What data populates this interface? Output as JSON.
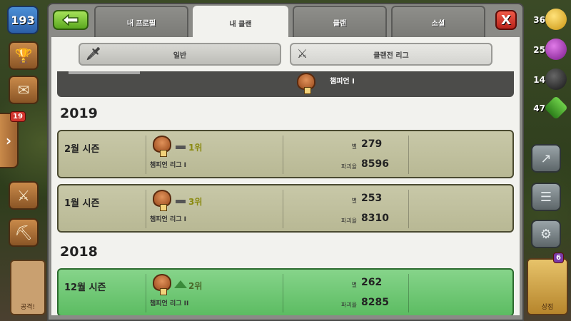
{
  "hud": {
    "level": "193",
    "messages_badge": "19",
    "attack_label": "공격!",
    "shop_badge": "6",
    "shop_label": "상점",
    "resources": [
      {
        "name": "gold",
        "value": "36"
      },
      {
        "name": "elixir",
        "value": "25"
      },
      {
        "name": "dark-elixir",
        "value": "14"
      },
      {
        "name": "gems",
        "value": "47"
      }
    ]
  },
  "tabs": [
    {
      "label": "내 프로필"
    },
    {
      "label": "내 클랜",
      "active": true
    },
    {
      "label": "클랜"
    },
    {
      "label": "소셜"
    }
  ],
  "subtabs": [
    {
      "label": "일반"
    },
    {
      "label": "클랜전 리그",
      "active": true
    }
  ],
  "header_league": "챔피언 I",
  "years": [
    "2019",
    "2018"
  ],
  "seasons": [
    {
      "name": "2월 시즌",
      "rank": "1위",
      "trend": "same",
      "league": "챔피언 리그 I",
      "star_label": "별",
      "stars": "279",
      "destruction_label": "파괴율",
      "destruction": "8596"
    },
    {
      "name": "1월 시즌",
      "rank": "3위",
      "trend": "same",
      "league": "챔피언 리그 I",
      "star_label": "별",
      "stars": "253",
      "destruction_label": "파괴율",
      "destruction": "8310"
    },
    {
      "name": "12월 시즌",
      "rank": "2위",
      "trend": "up",
      "league": "챔피언 리그 II",
      "star_label": "별",
      "stars": "262",
      "destruction_label": "파괴율",
      "destruction": "8285"
    }
  ],
  "colors": {
    "season_bg": "#c8c8a8",
    "current_season_bg": "#86d48a",
    "active_tab": "#f2f2ee"
  }
}
